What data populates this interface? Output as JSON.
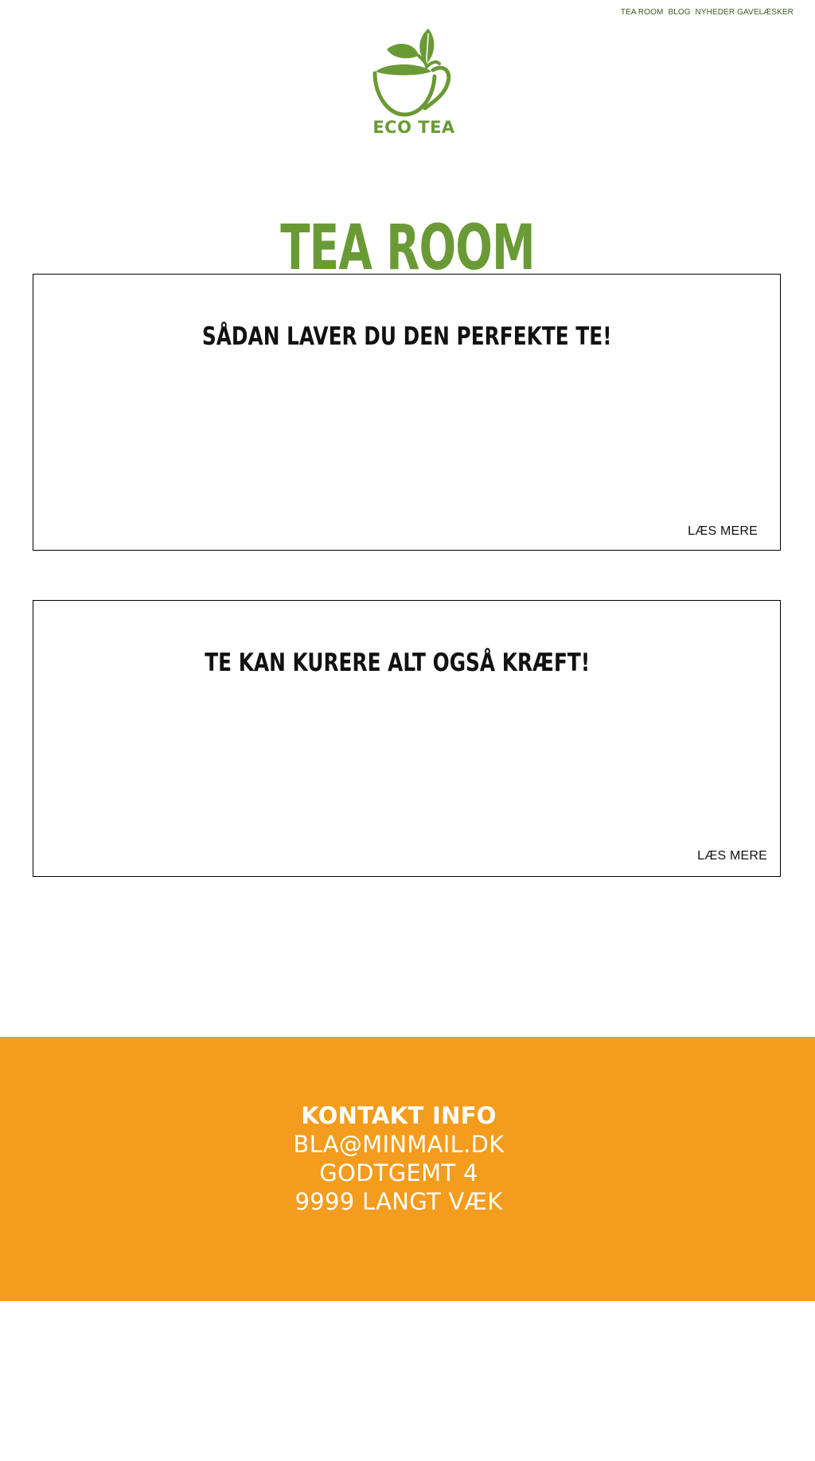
{
  "nav": {
    "items": [
      "TEA ROOM",
      "BLOG",
      "NYHEDER",
      "GAVELÆSKER"
    ]
  },
  "logo": {
    "text": "ECO TEA",
    "color": "#6a9a35"
  },
  "page": {
    "title": "TEA ROOM"
  },
  "articles": [
    {
      "title": "SÅDAN LAVER DU DEN PERFEKTE TE!",
      "read_more": "LÆS MERE"
    },
    {
      "title": "TE KAN KURERE ALT OGSÅ KRÆFT!",
      "read_more": "LÆS MERE"
    }
  ],
  "footer": {
    "heading": "KONTAKT INFO",
    "email": "BLA@MINMAIL.DK",
    "street": "GODTGEMT 4",
    "city": "9999 LANGT VÆK",
    "background": "#f49c1d"
  },
  "icons": {
    "logo": "tea-cup-leaf-icon"
  }
}
